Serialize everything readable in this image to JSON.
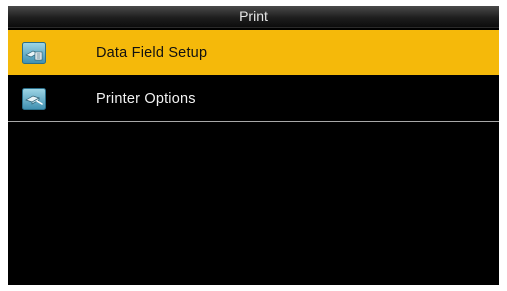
{
  "title_bar": {
    "title": "Print"
  },
  "menu": {
    "items": [
      {
        "label": "Data Field Setup",
        "icon": "data-field-icon",
        "selected": true
      },
      {
        "label": "Printer Options",
        "icon": "printer-options-icon",
        "selected": false
      }
    ]
  },
  "colors": {
    "background": "#000000",
    "selection": "#f5b90a",
    "title_text": "#e6e6e6",
    "item_text": "#f2f2f2",
    "selected_item_text": "#111111"
  }
}
